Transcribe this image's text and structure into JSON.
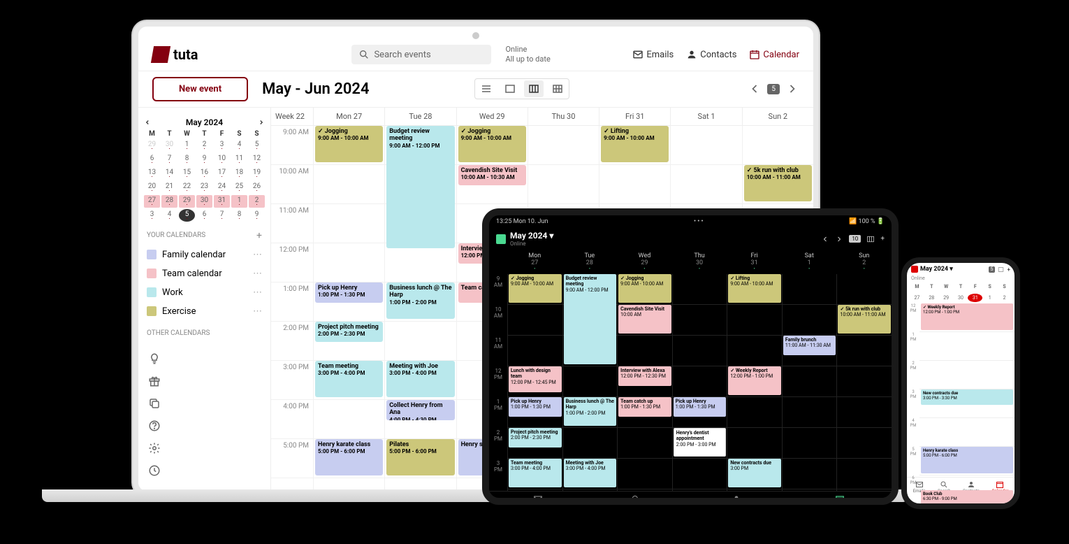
{
  "brand": "tuta",
  "header": {
    "search_placeholder": "Search events",
    "status_line1": "Online",
    "status_line2": "All up to date",
    "nav_emails": "Emails",
    "nav_contacts": "Contacts",
    "nav_calendar": "Calendar"
  },
  "toolbar": {
    "new_event": "New event",
    "title": "May - Jun 2024",
    "today_chip": "5"
  },
  "mini_cal": {
    "title": "May 2024",
    "dow": [
      "M",
      "T",
      "W",
      "T",
      "F",
      "S",
      "S"
    ],
    "rows": [
      [
        {
          "n": "29",
          "dim": true
        },
        {
          "n": "30",
          "dim": true
        },
        {
          "n": "1"
        },
        {
          "n": "2"
        },
        {
          "n": "3"
        },
        {
          "n": "4"
        },
        {
          "n": "5"
        }
      ],
      [
        {
          "n": "6"
        },
        {
          "n": "7"
        },
        {
          "n": "8"
        },
        {
          "n": "9"
        },
        {
          "n": "10"
        },
        {
          "n": "11"
        },
        {
          "n": "12"
        }
      ],
      [
        {
          "n": "13"
        },
        {
          "n": "14"
        },
        {
          "n": "15"
        },
        {
          "n": "16"
        },
        {
          "n": "17"
        },
        {
          "n": "18"
        },
        {
          "n": "19"
        }
      ],
      [
        {
          "n": "20"
        },
        {
          "n": "21"
        },
        {
          "n": "22"
        },
        {
          "n": "23"
        },
        {
          "n": "24"
        },
        {
          "n": "25"
        },
        {
          "n": "26"
        }
      ],
      [
        {
          "n": "27",
          "hl": true
        },
        {
          "n": "28",
          "hl": true
        },
        {
          "n": "29",
          "hl": true
        },
        {
          "n": "30",
          "hl": true
        },
        {
          "n": "31",
          "hl": true
        },
        {
          "n": "1",
          "hl": true
        },
        {
          "n": "2",
          "hl": true
        }
      ],
      [
        {
          "n": "3"
        },
        {
          "n": "4"
        },
        {
          "n": "5",
          "today": true
        },
        {
          "n": "6"
        },
        {
          "n": "7"
        },
        {
          "n": "8"
        },
        {
          "n": "9"
        }
      ]
    ]
  },
  "sidebar": {
    "your_calendars": "YOUR CALENDARS",
    "other_calendars": "OTHER CALENDARS",
    "calendars": [
      {
        "name": "Family calendar",
        "color": "#c7cdf0"
      },
      {
        "name": "Team calendar",
        "color": "#f5c2c7"
      },
      {
        "name": "Work",
        "color": "#b9e8ec"
      },
      {
        "name": "Exercise",
        "color": "#ccc77a"
      }
    ]
  },
  "grid": {
    "week_label": "Week 22",
    "days": [
      "Mon  27",
      "Tue  28",
      "Wed  29",
      "Thu  30",
      "Fri  31",
      "Sat  1",
      "Sun  2"
    ],
    "hours": [
      "9:00 AM",
      "10:00 AM",
      "11:00 AM",
      "12:00 PM",
      "1:00 PM",
      "2:00 PM",
      "3:00 PM",
      "4:00 PM",
      "5:00 PM"
    ],
    "events": [
      {
        "day": 0,
        "start": 0,
        "dur": 1,
        "cls": "c-exercise",
        "title": "✓ Jogging",
        "time": "9:00 AM - 10:00 AM"
      },
      {
        "day": 1,
        "start": 0,
        "dur": 3.2,
        "cls": "c-work",
        "title": "Budget review meeting",
        "time": "9:00 AM - 12:00 PM"
      },
      {
        "day": 2,
        "start": 0,
        "dur": 1,
        "cls": "c-exercise",
        "title": "✓ Jogging",
        "time": "9:00 AM - 10:00 AM"
      },
      {
        "day": 4,
        "start": 0,
        "dur": 1,
        "cls": "c-exercise",
        "title": "✓ Lifting",
        "time": "9:00 AM - 10:00 AM"
      },
      {
        "day": 6,
        "start": 1,
        "dur": 1,
        "cls": "c-exercise",
        "title": "✓ 5k run with club",
        "time": "10:00 AM - 11:00 AM"
      },
      {
        "day": 2,
        "start": 1,
        "dur": 0.6,
        "cls": "c-team",
        "title": "Cavendish Site Visit",
        "time": "10:00 AM - 10:30 AM"
      },
      {
        "day": 2,
        "start": 3,
        "dur": 0.6,
        "cls": "c-team",
        "title": "Interview",
        "time": "12:00 PM"
      },
      {
        "day": 0,
        "start": 4,
        "dur": 0.6,
        "cls": "c-family",
        "title": "Pick up Henry",
        "time": "1:00 PM - 1:30 PM"
      },
      {
        "day": 1,
        "start": 4,
        "dur": 1,
        "cls": "c-work",
        "title": "Business lunch @ The Harp",
        "time": "1:00 PM - 2:00 PM"
      },
      {
        "day": 2,
        "start": 4,
        "dur": 0.6,
        "cls": "c-team",
        "title": "Team cat",
        "time": ""
      },
      {
        "day": 0,
        "start": 5,
        "dur": 0.6,
        "cls": "c-work",
        "title": "Project pitch meeting",
        "time": "2:00 PM - 2:30 PM"
      },
      {
        "day": 0,
        "start": 6,
        "dur": 1,
        "cls": "c-work",
        "title": "Team meeting",
        "time": "3:00 PM - 4:00 PM"
      },
      {
        "day": 1,
        "start": 6,
        "dur": 1,
        "cls": "c-work",
        "title": "Meeting with Joe",
        "time": "3:00 PM - 4:00 PM"
      },
      {
        "day": 1,
        "start": 7,
        "dur": 0.6,
        "cls": "c-family",
        "title": "Collect Henry from Ana",
        "time": "4:00 PM - 4:30 PM"
      },
      {
        "day": 0,
        "start": 8,
        "dur": 1,
        "cls": "c-family",
        "title": "Henry karate class",
        "time": "5:00 PM - 6:00 PM"
      },
      {
        "day": 1,
        "start": 8,
        "dur": 1,
        "cls": "c-exercise",
        "title": "Pilates",
        "time": "5:00 PM - 6:00 PM"
      },
      {
        "day": 2,
        "start": 8,
        "dur": 1,
        "cls": "c-family",
        "title": "Henry sc",
        "time": ""
      }
    ]
  },
  "tablet": {
    "status_left": "13:25  Mon 10. Jun",
    "status_right": "📶 100 % 🔋",
    "title": "May 2024",
    "online": "Online",
    "chip": "10",
    "days": [
      {
        "name": "Mon",
        "num": "27"
      },
      {
        "name": "Tue",
        "num": "28"
      },
      {
        "name": "Wed",
        "num": "29"
      },
      {
        "name": "Thu",
        "num": "30"
      },
      {
        "name": "Fri",
        "num": "31"
      },
      {
        "name": "Sat",
        "num": "1"
      },
      {
        "name": "Sun",
        "num": "2"
      }
    ],
    "hours": [
      "9\nAM",
      "10\nAM",
      "11\nAM",
      "12\nPM",
      "1\nPM",
      "2\nPM",
      "3\nPM"
    ],
    "events": [
      {
        "day": 0,
        "start": 0,
        "dur": 1,
        "cls": "c-exercise",
        "title": "✓ Jogging",
        "time": "9:00 AM - 10:00 AM"
      },
      {
        "day": 1,
        "start": 0,
        "dur": 3,
        "cls": "c-work",
        "title": "Budget review meeting",
        "time": "9:00 AM - 12:00 PM"
      },
      {
        "day": 2,
        "start": 0,
        "dur": 1,
        "cls": "c-exercise",
        "title": "✓ Jogging",
        "time": "9:00 AM - 10:00 AM"
      },
      {
        "day": 4,
        "start": 0,
        "dur": 1,
        "cls": "c-exercise",
        "title": "✓ Lifting",
        "time": "9:00 AM - 10:00 AM"
      },
      {
        "day": 6,
        "start": 1,
        "dur": 1,
        "cls": "c-exercise",
        "title": "✓ 5k run with club",
        "time": "10:00 AM - 11:00 AM"
      },
      {
        "day": 2,
        "start": 1,
        "dur": 1,
        "cls": "c-team",
        "title": "Cavendish Site Visit",
        "time": "10:00 AM"
      },
      {
        "day": 5,
        "start": 2,
        "dur": 0.7,
        "cls": "c-family",
        "title": "Family brunch",
        "time": "11:00 AM - 11:30 AM"
      },
      {
        "day": 0,
        "start": 3,
        "dur": 0.9,
        "cls": "c-team",
        "title": "Lunch with design team",
        "time": "12:00 PM - 12:45 PM"
      },
      {
        "day": 2,
        "start": 3,
        "dur": 0.7,
        "cls": "c-team",
        "title": "Interview with Alexa",
        "time": "12:00 PM - 12:30 PM"
      },
      {
        "day": 4,
        "start": 3,
        "dur": 1,
        "cls": "c-team",
        "title": "✓ Weekly Report",
        "time": "12:00 PM - 1:00 PM"
      },
      {
        "day": 0,
        "start": 4,
        "dur": 0.7,
        "cls": "c-family",
        "title": "Pick up Henry",
        "time": "1:00 PM - 1:30 PM"
      },
      {
        "day": 1,
        "start": 4,
        "dur": 1,
        "cls": "c-work",
        "title": "Business lunch @ The Harp",
        "time": "1:00 PM - 2:00 PM"
      },
      {
        "day": 2,
        "start": 4,
        "dur": 0.7,
        "cls": "c-team",
        "title": "Team catch up",
        "time": "1:00 PM - 1:30 PM"
      },
      {
        "day": 3,
        "start": 4,
        "dur": 0.7,
        "cls": "c-family",
        "title": "Pick up Henry",
        "time": "1:00 PM - 1:30 PM"
      },
      {
        "day": 0,
        "start": 5,
        "dur": 0.7,
        "cls": "c-work",
        "title": "Project pitch meeting",
        "time": "2:00 PM - 2:30 PM"
      },
      {
        "day": 3,
        "start": 5,
        "dur": 1,
        "cls": "c-white",
        "title": "Henry's dentist appointment",
        "time": "2:00 PM - 3:00 PM"
      },
      {
        "day": 0,
        "start": 6,
        "dur": 1,
        "cls": "c-work",
        "title": "Team meeting",
        "time": "3:00 PM - 4:00 PM"
      },
      {
        "day": 1,
        "start": 6,
        "dur": 1,
        "cls": "c-work",
        "title": "Meeting with Joe",
        "time": "3:00 PM - 4:00 PM"
      },
      {
        "day": 4,
        "start": 6,
        "dur": 1,
        "cls": "c-work",
        "title": "New contracts due",
        "time": "3:00 PM"
      }
    ],
    "nav": [
      "Emails",
      "Search",
      "Contacts",
      "Calendar"
    ]
  },
  "phone": {
    "title": "May 2024",
    "online": "Online",
    "chip": "5",
    "dow": [
      "M",
      "T",
      "W",
      "T",
      "F",
      "S",
      "S"
    ],
    "dates": [
      "27",
      "28",
      "29",
      "30",
      "31",
      "1",
      "2"
    ],
    "today_idx": 4,
    "hours": [
      "12\nPM",
      "1\nPM",
      "2\nPM",
      "3\nPM",
      "4\nPM",
      "5\nPM",
      "6\nPM"
    ],
    "events": [
      {
        "start": 0,
        "dur": 1,
        "cls": "c-team",
        "title": "✓ Weekly Report",
        "time": "12:00 PM - 1:00 PM"
      },
      {
        "start": 3,
        "dur": 0.6,
        "cls": "c-work",
        "title": "New contracts due",
        "time": "3:00 PM - 3:30 PM"
      },
      {
        "start": 5,
        "dur": 1,
        "cls": "c-family",
        "title": "Henry karate class",
        "time": "5:00 PM - 6:00 PM"
      },
      {
        "start": 6.5,
        "dur": 1,
        "cls": "c-team",
        "title": "Book Club",
        "time": "6:30 PM - 9:00 PM"
      }
    ],
    "nav": [
      "Emails",
      "Search",
      "Contacts",
      "Calendar"
    ]
  }
}
